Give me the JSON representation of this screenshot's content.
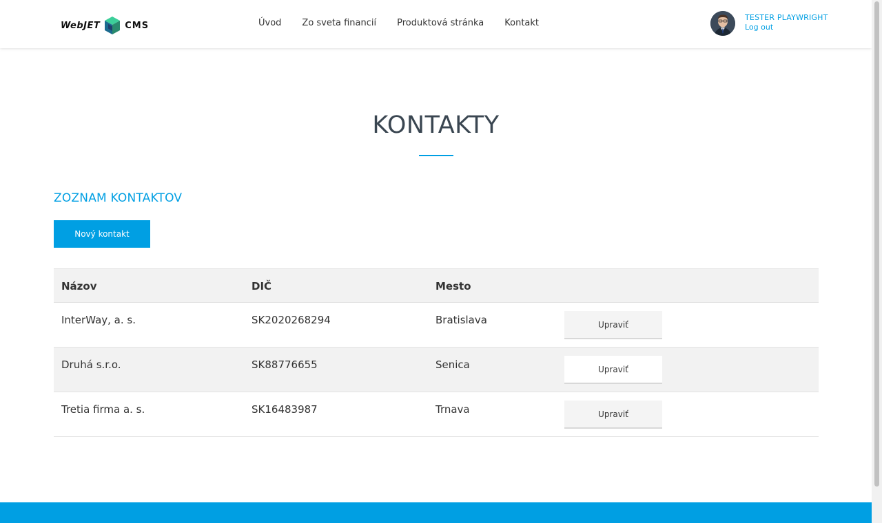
{
  "header": {
    "logo": {
      "text_left": "WebJET",
      "text_right": "CMS",
      "accent": "#2a8a6e"
    },
    "nav": [
      {
        "label": "Úvod"
      },
      {
        "label": "Zo sveta financií"
      },
      {
        "label": "Produktová stránka"
      },
      {
        "label": "Kontakt"
      }
    ],
    "user": {
      "name": "TESTER PLAYWRIGHT",
      "logout": "Log out"
    }
  },
  "main": {
    "title": "KONTAKTY",
    "section_title": "ZOZNAM KONTAKTOV",
    "new_button": "Nový kontakt",
    "table": {
      "columns": [
        "Názov",
        "DIČ",
        "Mesto"
      ],
      "rows": [
        {
          "name": "InterWay, a. s.",
          "dic": "SK2020268294",
          "city": "Bratislava",
          "action": "Upraviť"
        },
        {
          "name": "Druhá s.r.o.",
          "dic": "SK88776655",
          "city": "Senica",
          "action": "Upraviť"
        },
        {
          "name": "Tretia firma a. s.",
          "dic": "SK16483987",
          "city": "Trnava",
          "action": "Upraviť"
        }
      ]
    }
  },
  "colors": {
    "accent": "#009fe3",
    "text": "#333333",
    "title": "#3a4651",
    "row_alt": "#f2f2f2"
  }
}
